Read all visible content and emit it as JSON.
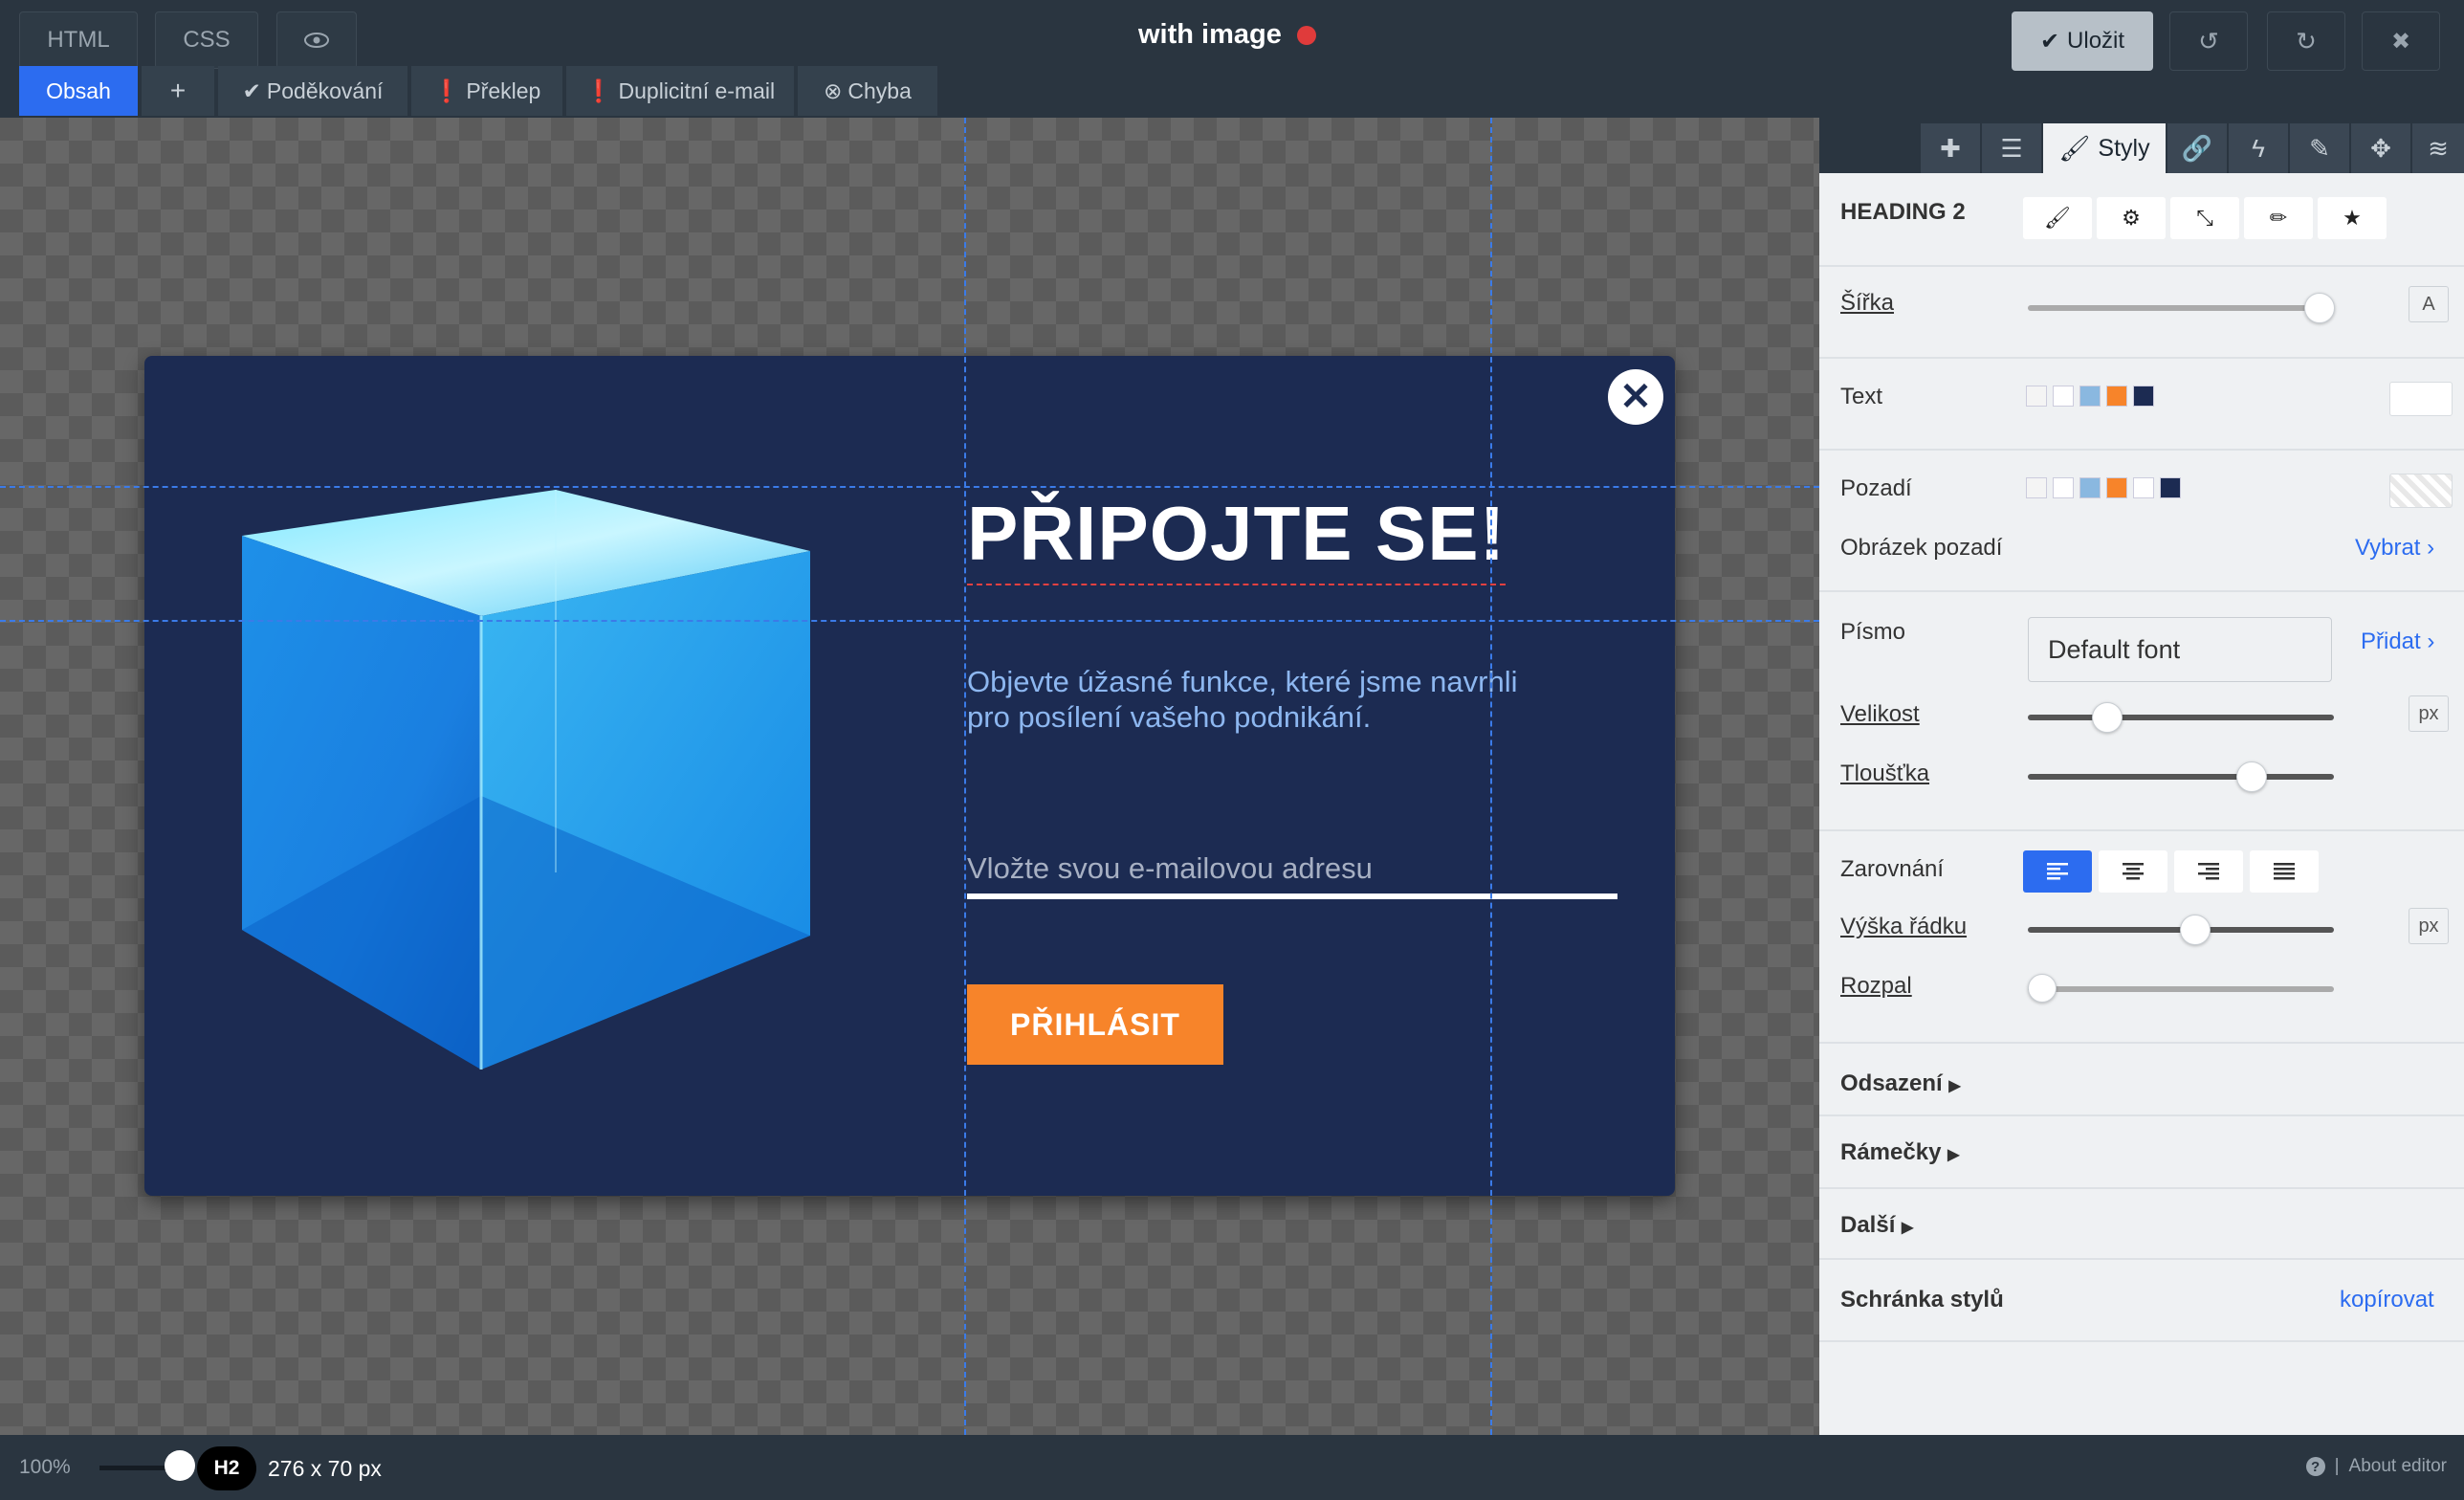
{
  "topbar": {
    "html_tab": "HTML",
    "css_tab": "CSS",
    "preview_icon": "eye-icon",
    "title": "with image",
    "save_label": "Uložit",
    "undo_icon": "undo-icon",
    "redo_icon": "redo-icon",
    "close_icon": "close-icon"
  },
  "tabs": [
    {
      "label": "Obsah",
      "active": true
    },
    {
      "label": "+",
      "active": false
    },
    {
      "label": "Poděkování",
      "icon": "check-circle-icon"
    },
    {
      "label": "Překlep",
      "icon": "exclamation-circle-icon"
    },
    {
      "label": "Duplicitní e-mail",
      "icon": "exclamation-circle-icon"
    },
    {
      "label": "Chyba",
      "icon": "x-circle-icon"
    }
  ],
  "popup": {
    "heading": "PŘIPOJTE SE!",
    "subtext": "Objevte úžasné funkce, které jsme navrhli pro posílení vašeho podnikání.",
    "email_placeholder": "Vložte svou e-mailovou adresu",
    "button_label": "PŘIHLÁSIT",
    "close_icon": "close-circle-icon",
    "colors": {
      "background": "#1c2b52",
      "button": "#f7842a",
      "subtext": "#8db7f0"
    }
  },
  "panel_tabs": [
    {
      "icon": "plus-icon"
    },
    {
      "icon": "list-icon"
    },
    {
      "icon": "brush-icon",
      "label": "Styly",
      "active": true
    },
    {
      "icon": "link-icon"
    },
    {
      "icon": "bolt-icon"
    },
    {
      "icon": "edit-icon"
    },
    {
      "icon": "move-icon"
    },
    {
      "icon": "database-icon"
    }
  ],
  "panel": {
    "element_title": "HEADING 2",
    "width_label": "Šířka",
    "width_unit": "A",
    "text_label": "Text",
    "background_label": "Pozadí",
    "bg_image_label": "Obrázek pozadí",
    "bg_image_link": "Vybrat",
    "font_label": "Písmo",
    "font_value": "Default font",
    "font_add_link": "Přidat",
    "size_label": "Velikost",
    "size_unit": "px",
    "weight_label": "Tloušťka",
    "align_label": "Zarovnání",
    "line_height_label": "Výška řádku",
    "line_height_unit": "px",
    "spacing_label": "Rozpal",
    "padding_label": "Odsazení",
    "borders_label": "Rámečky",
    "more_label": "Další",
    "clipboard_label": "Schránka stylů",
    "clipboard_link": "kopírovat",
    "sliders": {
      "width": 0.95,
      "size": 0.26,
      "weight": 0.73,
      "line_height": 0.55,
      "spacing": 0.05
    },
    "swatches": [
      "#ffffff",
      "#8ab8e0",
      "#f7842a",
      "#1c2b52"
    ]
  },
  "status": {
    "zoom": "100%",
    "tag": "H2",
    "dimensions": "276 x 70 px",
    "about": "About editor"
  }
}
